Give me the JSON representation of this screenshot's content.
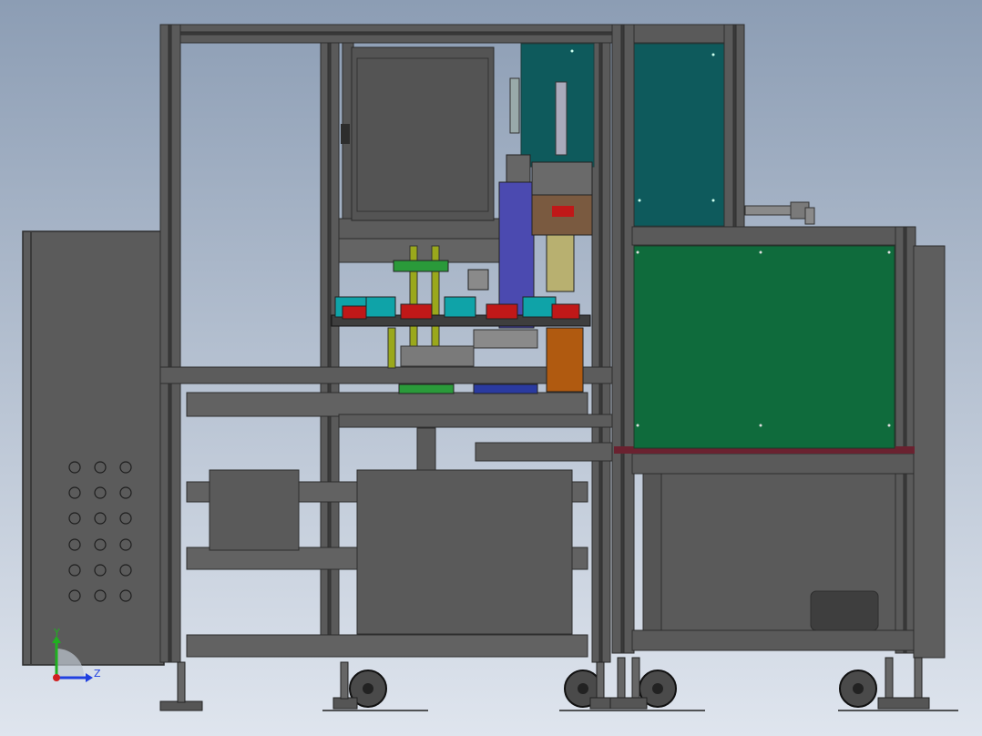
{
  "colors": {
    "bg_top": "#8c9db4",
    "bg_bottom": "#dfe5ee",
    "frame": "#555555",
    "frame_dark": "#2d2d2d",
    "panel_teal": "#0e5a5c",
    "panel_green": "#0f6b3c",
    "cabinet": "#5b5b5b",
    "purple": "#4b4ab0",
    "red": "#c01818",
    "cyan": "#0fa3a8",
    "orange": "#b05a10",
    "yellow": "#9aa81c",
    "maroon": "#6a2230"
  },
  "triad": {
    "y_label": "Y",
    "z_label": "Z",
    "y_color": "#20b020",
    "z_color": "#2040e0",
    "origin_color": "#d02020"
  },
  "icons": [
    "coordinate-triad-icon"
  ]
}
